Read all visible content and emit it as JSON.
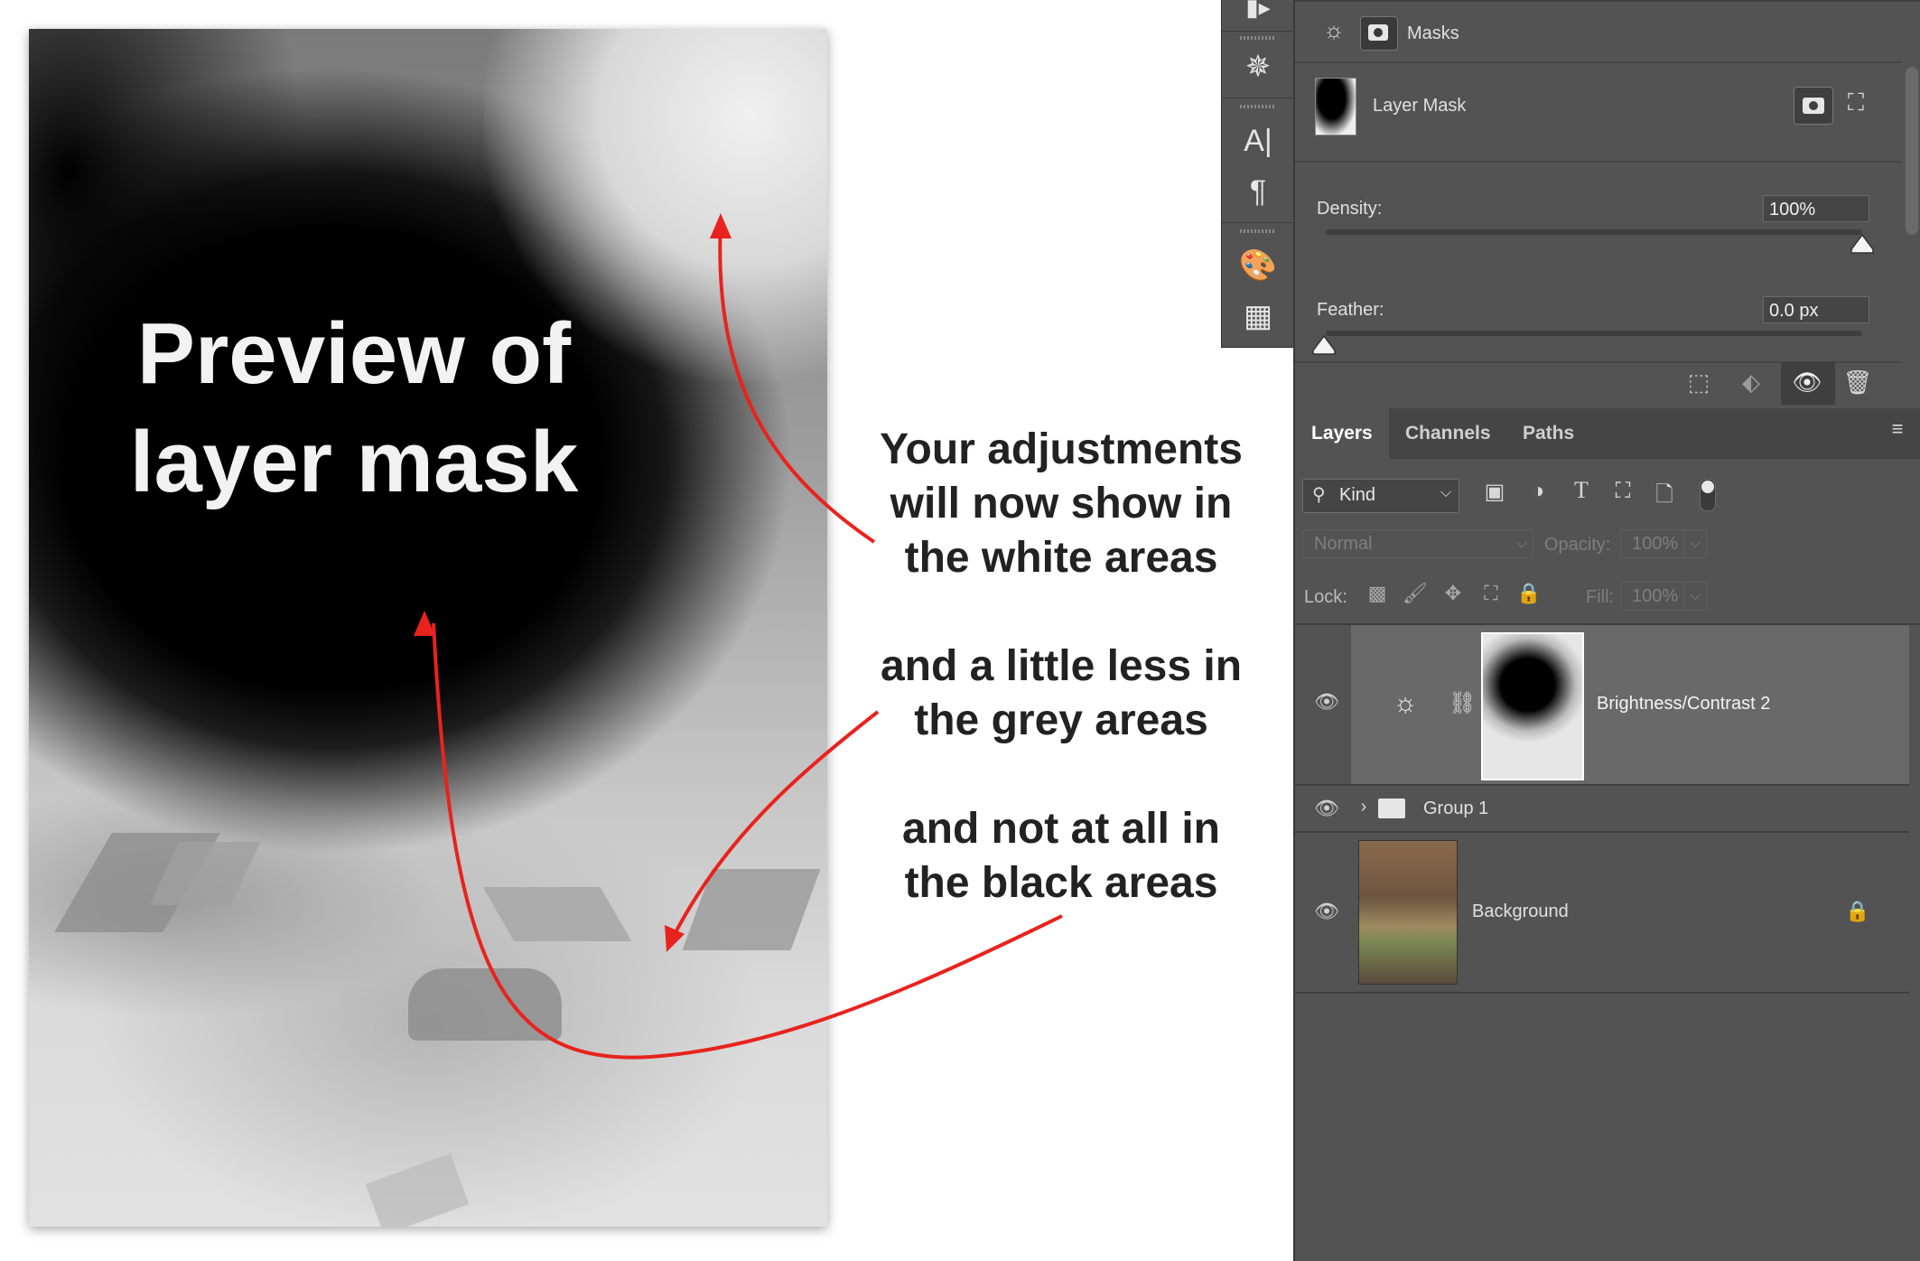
{
  "preview": {
    "title_line1": "Preview of",
    "title_line2": "layer mask"
  },
  "annotations": {
    "note1_line1": "Your adjustments",
    "note1_line2": "will now show in",
    "note1_line3": "the white areas",
    "note2_line1": "and a little less in",
    "note2_line2": "the grey areas",
    "note3_line1": "and not at all in",
    "note3_line2": "the black areas",
    "arrow_color": "#e8231d"
  },
  "properties": {
    "tab_label": "Masks",
    "mask_label": "Layer Mask",
    "density_label": "Density:",
    "density_value": "100%",
    "density_level": 1.0,
    "feather_label": "Feather:",
    "feather_value": "0.0 px",
    "feather_level": 0.0
  },
  "layers_panel": {
    "tabs": [
      "Layers",
      "Channels",
      "Paths"
    ],
    "active_tab": "Layers",
    "filter_kind": "Kind",
    "blend_mode": "Normal",
    "opacity_label": "Opacity:",
    "opacity_value": "100%",
    "lock_label": "Lock:",
    "fill_label": "Fill:",
    "fill_value": "100%",
    "layers": [
      {
        "name": "Brightness/Contrast 2",
        "type": "adjustment",
        "selected": true
      },
      {
        "name": "Group 1",
        "type": "group",
        "selected": false
      },
      {
        "name": "Background",
        "type": "pixel",
        "locked": true,
        "selected": false
      }
    ]
  },
  "colors": {
    "panel_bg": "#535353",
    "selected_row": "#696969",
    "arrow": "#e8231d"
  }
}
